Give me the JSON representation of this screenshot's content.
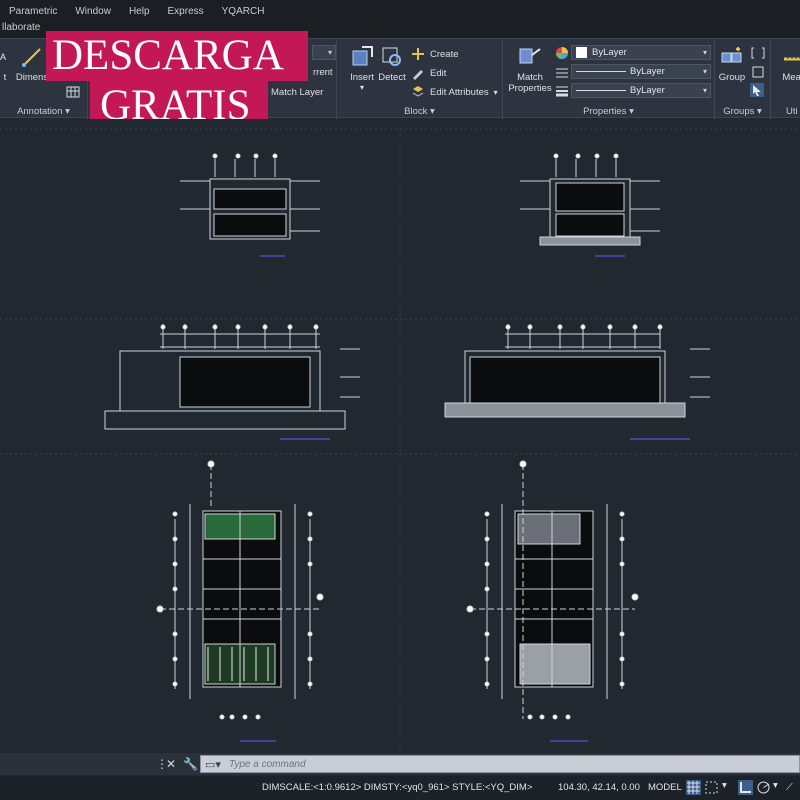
{
  "menu": [
    "Parametric",
    "Window",
    "Help",
    "Express",
    "YQARCH"
  ],
  "tab_label": "llaborate",
  "promo": {
    "line1": "DESCARGA",
    "line2": "GRATIS"
  },
  "ribbon": {
    "annotation": {
      "title": "Annotation",
      "text_btn": "t",
      "dimension_btn": "Dimens"
    },
    "layers": {
      "current_btn": "rrent",
      "match_layer_btn": "Match Layer"
    },
    "block": {
      "title": "Block",
      "insert_btn": "Insert",
      "detect_btn": "Detect",
      "create_btn": "Create",
      "edit_btn": "Edit",
      "edit_attributes_btn": "Edit Attributes"
    },
    "properties": {
      "title": "Properties",
      "match_properties_line1": "Match",
      "match_properties_line2": "Properties",
      "color_value": "ByLayer",
      "linetype_value": "ByLayer",
      "lineweight_value": "ByLayer"
    },
    "groups": {
      "title": "Groups",
      "group_btn": "Group"
    },
    "utilities": {
      "title": "Uti",
      "measure_btn": "Meas"
    }
  },
  "command": {
    "placeholder": "Type a command"
  },
  "status": {
    "dim_info": "DIMSCALE:<1:0.9612> DIMSTY:<yq0_961> STYLE:<YQ_DIM>",
    "coords": "104.30, 42.14, 0.00",
    "mode": "MODEL"
  },
  "colors": {
    "accent": "#c31756",
    "background": "#212830",
    "ribbon": "#2d3440"
  }
}
